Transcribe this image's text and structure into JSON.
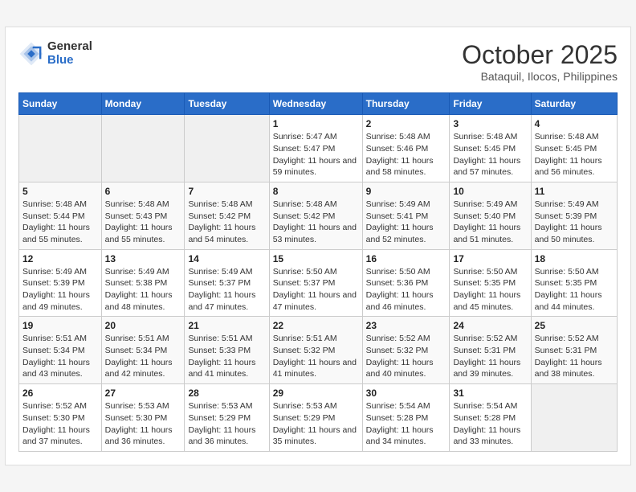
{
  "header": {
    "logo_text_general": "General",
    "logo_text_blue": "Blue",
    "month_title": "October 2025",
    "subtitle": "Bataquil, Ilocos, Philippines"
  },
  "days_of_week": [
    "Sunday",
    "Monday",
    "Tuesday",
    "Wednesday",
    "Thursday",
    "Friday",
    "Saturday"
  ],
  "weeks": [
    [
      {
        "day": "",
        "empty": true
      },
      {
        "day": "",
        "empty": true
      },
      {
        "day": "",
        "empty": true
      },
      {
        "day": "1",
        "sunrise": "Sunrise: 5:47 AM",
        "sunset": "Sunset: 5:47 PM",
        "daylight": "Daylight: 11 hours and 59 minutes."
      },
      {
        "day": "2",
        "sunrise": "Sunrise: 5:48 AM",
        "sunset": "Sunset: 5:46 PM",
        "daylight": "Daylight: 11 hours and 58 minutes."
      },
      {
        "day": "3",
        "sunrise": "Sunrise: 5:48 AM",
        "sunset": "Sunset: 5:45 PM",
        "daylight": "Daylight: 11 hours and 57 minutes."
      },
      {
        "day": "4",
        "sunrise": "Sunrise: 5:48 AM",
        "sunset": "Sunset: 5:45 PM",
        "daylight": "Daylight: 11 hours and 56 minutes."
      }
    ],
    [
      {
        "day": "5",
        "sunrise": "Sunrise: 5:48 AM",
        "sunset": "Sunset: 5:44 PM",
        "daylight": "Daylight: 11 hours and 55 minutes."
      },
      {
        "day": "6",
        "sunrise": "Sunrise: 5:48 AM",
        "sunset": "Sunset: 5:43 PM",
        "daylight": "Daylight: 11 hours and 55 minutes."
      },
      {
        "day": "7",
        "sunrise": "Sunrise: 5:48 AM",
        "sunset": "Sunset: 5:42 PM",
        "daylight": "Daylight: 11 hours and 54 minutes."
      },
      {
        "day": "8",
        "sunrise": "Sunrise: 5:48 AM",
        "sunset": "Sunset: 5:42 PM",
        "daylight": "Daylight: 11 hours and 53 minutes."
      },
      {
        "day": "9",
        "sunrise": "Sunrise: 5:49 AM",
        "sunset": "Sunset: 5:41 PM",
        "daylight": "Daylight: 11 hours and 52 minutes."
      },
      {
        "day": "10",
        "sunrise": "Sunrise: 5:49 AM",
        "sunset": "Sunset: 5:40 PM",
        "daylight": "Daylight: 11 hours and 51 minutes."
      },
      {
        "day": "11",
        "sunrise": "Sunrise: 5:49 AM",
        "sunset": "Sunset: 5:39 PM",
        "daylight": "Daylight: 11 hours and 50 minutes."
      }
    ],
    [
      {
        "day": "12",
        "sunrise": "Sunrise: 5:49 AM",
        "sunset": "Sunset: 5:39 PM",
        "daylight": "Daylight: 11 hours and 49 minutes."
      },
      {
        "day": "13",
        "sunrise": "Sunrise: 5:49 AM",
        "sunset": "Sunset: 5:38 PM",
        "daylight": "Daylight: 11 hours and 48 minutes."
      },
      {
        "day": "14",
        "sunrise": "Sunrise: 5:49 AM",
        "sunset": "Sunset: 5:37 PM",
        "daylight": "Daylight: 11 hours and 47 minutes."
      },
      {
        "day": "15",
        "sunrise": "Sunrise: 5:50 AM",
        "sunset": "Sunset: 5:37 PM",
        "daylight": "Daylight: 11 hours and 47 minutes."
      },
      {
        "day": "16",
        "sunrise": "Sunrise: 5:50 AM",
        "sunset": "Sunset: 5:36 PM",
        "daylight": "Daylight: 11 hours and 46 minutes."
      },
      {
        "day": "17",
        "sunrise": "Sunrise: 5:50 AM",
        "sunset": "Sunset: 5:35 PM",
        "daylight": "Daylight: 11 hours and 45 minutes."
      },
      {
        "day": "18",
        "sunrise": "Sunrise: 5:50 AM",
        "sunset": "Sunset: 5:35 PM",
        "daylight": "Daylight: 11 hours and 44 minutes."
      }
    ],
    [
      {
        "day": "19",
        "sunrise": "Sunrise: 5:51 AM",
        "sunset": "Sunset: 5:34 PM",
        "daylight": "Daylight: 11 hours and 43 minutes."
      },
      {
        "day": "20",
        "sunrise": "Sunrise: 5:51 AM",
        "sunset": "Sunset: 5:34 PM",
        "daylight": "Daylight: 11 hours and 42 minutes."
      },
      {
        "day": "21",
        "sunrise": "Sunrise: 5:51 AM",
        "sunset": "Sunset: 5:33 PM",
        "daylight": "Daylight: 11 hours and 41 minutes."
      },
      {
        "day": "22",
        "sunrise": "Sunrise: 5:51 AM",
        "sunset": "Sunset: 5:32 PM",
        "daylight": "Daylight: 11 hours and 41 minutes."
      },
      {
        "day": "23",
        "sunrise": "Sunrise: 5:52 AM",
        "sunset": "Sunset: 5:32 PM",
        "daylight": "Daylight: 11 hours and 40 minutes."
      },
      {
        "day": "24",
        "sunrise": "Sunrise: 5:52 AM",
        "sunset": "Sunset: 5:31 PM",
        "daylight": "Daylight: 11 hours and 39 minutes."
      },
      {
        "day": "25",
        "sunrise": "Sunrise: 5:52 AM",
        "sunset": "Sunset: 5:31 PM",
        "daylight": "Daylight: 11 hours and 38 minutes."
      }
    ],
    [
      {
        "day": "26",
        "sunrise": "Sunrise: 5:52 AM",
        "sunset": "Sunset: 5:30 PM",
        "daylight": "Daylight: 11 hours and 37 minutes."
      },
      {
        "day": "27",
        "sunrise": "Sunrise: 5:53 AM",
        "sunset": "Sunset: 5:30 PM",
        "daylight": "Daylight: 11 hours and 36 minutes."
      },
      {
        "day": "28",
        "sunrise": "Sunrise: 5:53 AM",
        "sunset": "Sunset: 5:29 PM",
        "daylight": "Daylight: 11 hours and 36 minutes."
      },
      {
        "day": "29",
        "sunrise": "Sunrise: 5:53 AM",
        "sunset": "Sunset: 5:29 PM",
        "daylight": "Daylight: 11 hours and 35 minutes."
      },
      {
        "day": "30",
        "sunrise": "Sunrise: 5:54 AM",
        "sunset": "Sunset: 5:28 PM",
        "daylight": "Daylight: 11 hours and 34 minutes."
      },
      {
        "day": "31",
        "sunrise": "Sunrise: 5:54 AM",
        "sunset": "Sunset: 5:28 PM",
        "daylight": "Daylight: 11 hours and 33 minutes."
      },
      {
        "day": "",
        "empty": true
      }
    ]
  ]
}
